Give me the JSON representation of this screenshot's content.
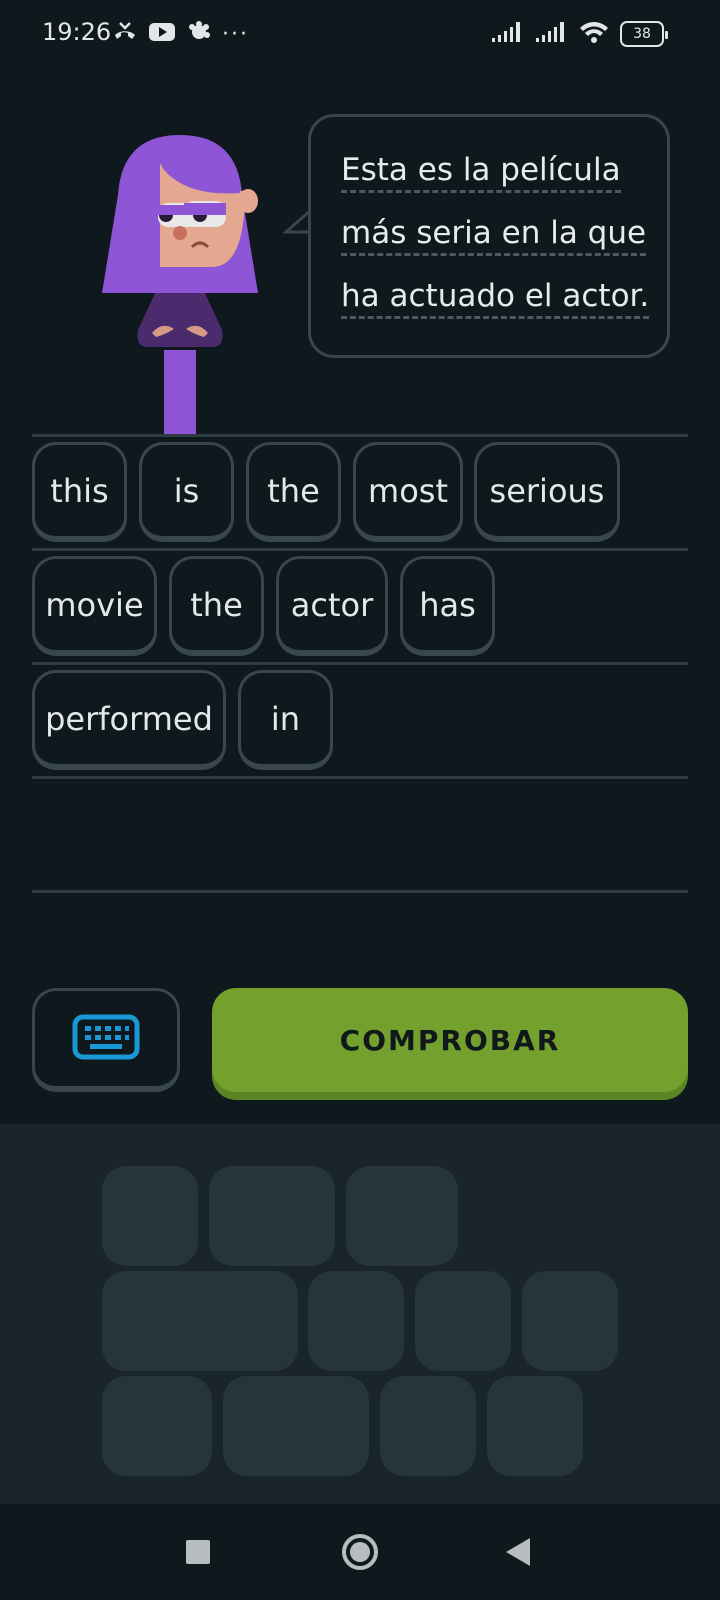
{
  "status_bar": {
    "time": "19:26",
    "left_icons": [
      "missed-call-icon",
      "youtube-icon",
      "app-notification-icon",
      "more-notifications-icon"
    ],
    "more_dots": "···",
    "right_icons": [
      "signal-icon",
      "signal-icon",
      "wifi-icon",
      "battery-icon"
    ],
    "battery_level": "38"
  },
  "prompt": {
    "lines": [
      "Esta es la película",
      "más seria en la que",
      "ha actuado el actor."
    ]
  },
  "answer_chips": [
    "this",
    "is",
    "the",
    "most",
    "serious",
    "movie",
    "the",
    "actor",
    "has",
    "performed",
    "in"
  ],
  "buttons": {
    "keyboard_icon": "keyboard-icon",
    "check_label": "COMPROBAR"
  },
  "colors": {
    "background": "#0f181c",
    "accent_green": "#74a12d",
    "keyboard_blue": "#1899d6",
    "character_purple": "#8e55d6"
  },
  "nav_bar": {
    "icons": [
      "recents-icon",
      "home-icon",
      "back-icon"
    ]
  }
}
